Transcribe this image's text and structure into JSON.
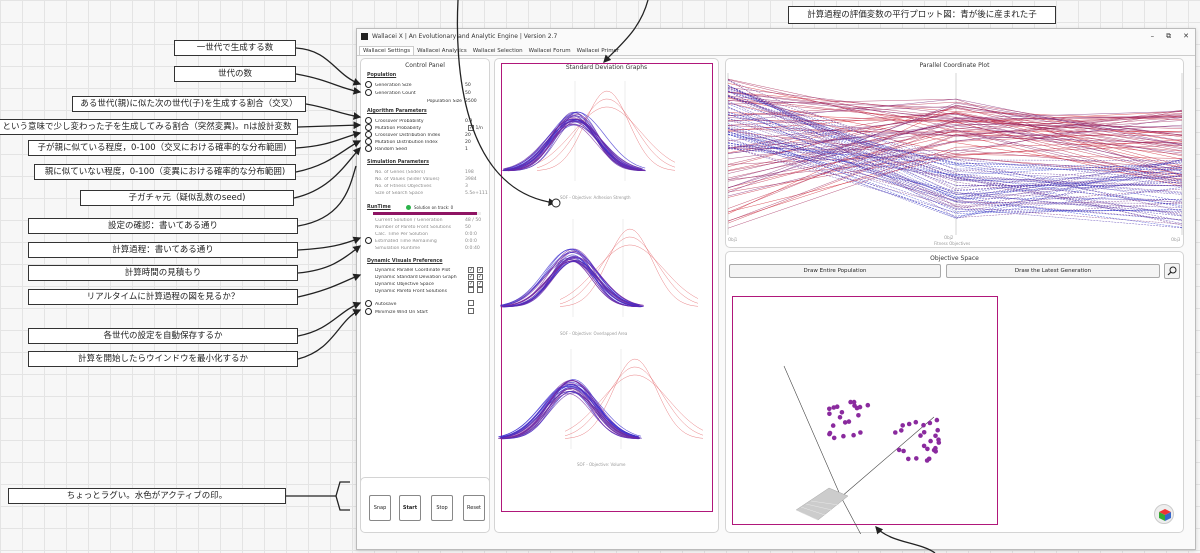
{
  "top_note": "計算過程の評価変数の平行プロット図：青が後に産まれた子",
  "annotations": [
    "一世代で生成する数",
    "世代の数",
    "ある世代(親)に似た次の世代(子)を生成する割合（交叉）",
    "という意味で少し変わった子を生成してみる割合（突然変異)。nは設計変数",
    "子が親に似ている程度，0-100（交叉における確率的な分布範囲)",
    "親に似ていない程度，0-100（変異における確率的な分布範囲)",
    "子ガチャ元（疑似乱数のseed)",
    "設定の確認：書いてある通り",
    "計算過程：書いてある通り",
    "計算時間の見積もり",
    "リアルタイムに計算過程の図を見るか？",
    "各世代の設定を自動保存するか",
    "計算を開始したらウインドウを最小化するか",
    "ちょっとラグい。水色がアクティブの印。"
  ],
  "window": {
    "title": "Wallacei X  |  An Evolutionary and Analytic Engine  |  Version 2.7",
    "controls": [
      "–",
      "⧉",
      "✕"
    ],
    "tabs": [
      "Wallacei Settings",
      "Wallacei Analytics",
      "Wallacei Selection",
      "Wallacei Forum",
      "Wallacei Primer"
    ]
  },
  "control_panel": {
    "title": "Control Panel",
    "population": {
      "heading": "Population",
      "rows": [
        {
          "label": "Generation Size",
          "value": "50"
        },
        {
          "label": "Generation Count",
          "value": "50"
        },
        {
          "label": "Population Size",
          "value": "2500"
        }
      ]
    },
    "algorithm": {
      "heading": "Algorithm Parameters",
      "rows": [
        {
          "label": "Crossover Probability",
          "value": "0.9"
        },
        {
          "label": "Mutation Probability",
          "value": "1/n"
        },
        {
          "label": "Crossover Distribution Index",
          "value": "20"
        },
        {
          "label": "Mutation Distribution Index",
          "value": "20"
        },
        {
          "label": "Random Seed",
          "value": "1"
        }
      ]
    },
    "simulation": {
      "heading": "Simulation Parameters",
      "rows": [
        {
          "label": "No. of Genes (Sliders)",
          "value": "198"
        },
        {
          "label": "No. of Values (Slider Values)",
          "value": "3984"
        },
        {
          "label": "No. of Fitness Objectives",
          "value": "3"
        },
        {
          "label": "Size of Search Space",
          "value": "5.5e+111"
        }
      ]
    },
    "runtime": {
      "heading": "RunTime",
      "status": "Solution on track: 0",
      "rows": [
        {
          "label": "Current Solution / Generation",
          "value": "48 / 50"
        },
        {
          "label": "Number of Pareto Front Solutions",
          "value": "50"
        },
        {
          "label": "Calc. Time Per Solution",
          "value": "0:0:0"
        },
        {
          "label": "Estimated Time Remaining",
          "value": "0:0:0"
        },
        {
          "label": "Simulation Runtime",
          "value": "0:0:40"
        }
      ],
      "progress": 0.96
    },
    "visuals": {
      "heading": "Dynamic Visuals Preference",
      "rows": [
        "Dynamic Parallel Coordinate Plot",
        "Dynamic Standard Deviation Graph",
        "Dynamic Objective Space",
        "Dynamic Pareto Front Solutions"
      ]
    },
    "autosave": "Autosave",
    "minimize": "Minimize Wnd On Start",
    "buttons": [
      "Snap",
      "Start",
      "Stop",
      "Reset"
    ]
  },
  "sd_panel": {
    "title": "Standard Deviation Graphs",
    "captions": [
      "SOF - Objective: Adhesion Strength",
      "SOF - Objective: Overlapped Area",
      "SOF - Objective: Volume"
    ]
  },
  "pcp_panel": {
    "title": "Parallel Coordinate Plot",
    "axis_label": "Fitness Objectives",
    "axis_ticks": [
      "Obj1",
      "Obj2",
      "Obj3"
    ]
  },
  "os_panel": {
    "title": "Objective Space",
    "btn_entire": "Draw Entire Population",
    "btn_latest": "Draw the Latest Generation",
    "zoom_icon": "magnifier-icon"
  },
  "colors": {
    "frame": "#b0177a",
    "purple": "#5b2aa8",
    "blue": "#1a2fd1",
    "red": "#d81f26",
    "green": "#2bb34a",
    "dot": "#8a2a9e"
  }
}
